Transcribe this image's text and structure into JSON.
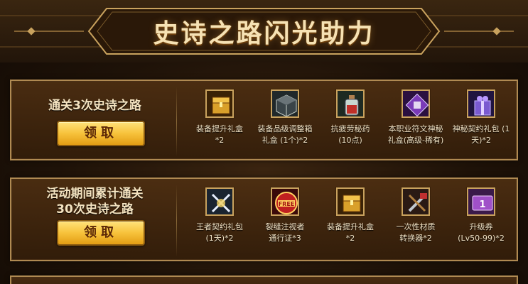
{
  "banner": {
    "title": "史诗之路闪光助力"
  },
  "rewards": [
    {
      "task": "通关3次史诗之路",
      "claim_label": "领取",
      "items": [
        {
          "icon": "gold-chest-icon",
          "name_line1": "装备提升礼盒",
          "name_line2": "*2"
        },
        {
          "icon": "dark-box-icon",
          "name_line1": "装备品级调整箱",
          "name_line2": "礼盒 (1个)*2"
        },
        {
          "icon": "potion-bottle-icon",
          "name_line1": "抗疲劳秘药",
          "name_line2": "(10点)"
        },
        {
          "icon": "purple-rune-icon",
          "name_line1": "本职业符文神秘",
          "name_line2": "礼盒(高级-稀有)"
        },
        {
          "icon": "purple-gift-icon",
          "name_line1": "神秘契约礼包 (1",
          "name_line2": "天)*2"
        }
      ]
    },
    {
      "task_line1": "活动期间累计通关",
      "task_line2": "30次史诗之路",
      "claim_label": "领取",
      "items": [
        {
          "icon": "crossed-swords-icon",
          "name_line1": "王者契约礼包",
          "name_line2": "(1天)*2"
        },
        {
          "icon": "free-ticket-icon",
          "name_line1": "裂缝注视者",
          "name_line2": "通行证*3"
        },
        {
          "icon": "gold-chest-icon",
          "name_line1": "装备提升礼盒",
          "name_line2": "*2"
        },
        {
          "icon": "material-converter-icon",
          "name_line1": "一次性材质",
          "name_line2": "转换器*2"
        },
        {
          "icon": "level-up-ticket-icon",
          "name_line1": "升级券",
          "name_line2": "(Lv50-99)*2"
        }
      ]
    }
  ]
}
